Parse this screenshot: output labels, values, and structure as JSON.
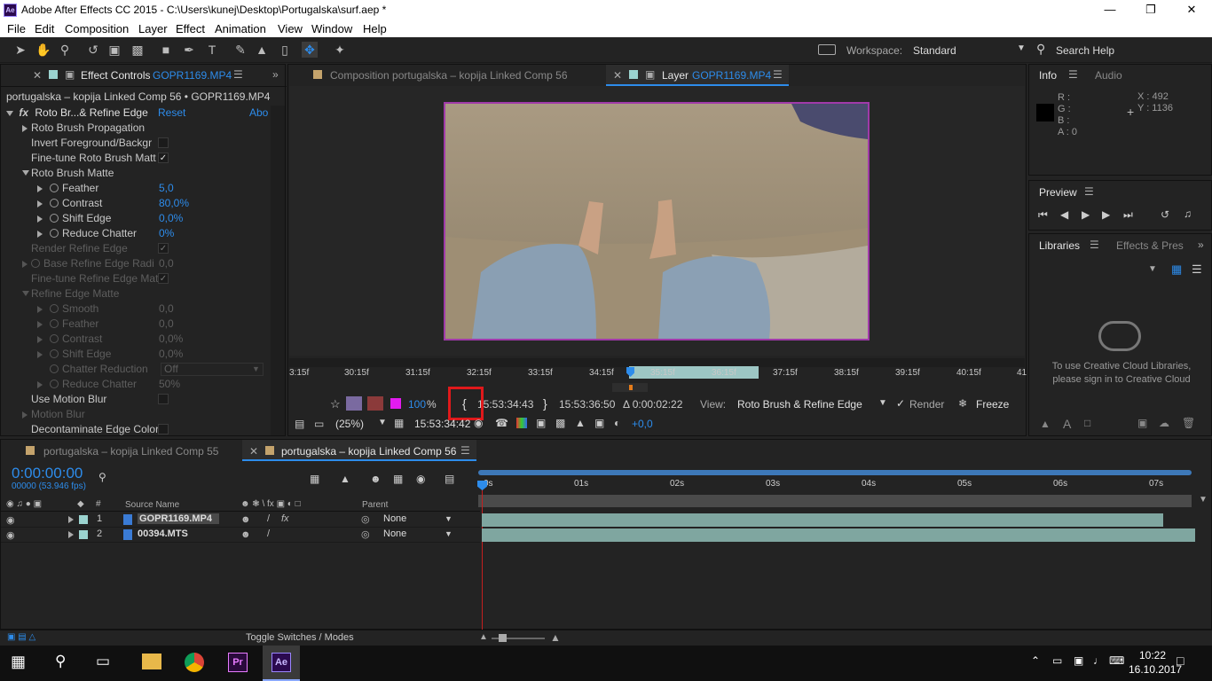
{
  "window": {
    "title": "Adobe After Effects CC 2015 - C:\\Users\\kunej\\Desktop\\Portugalska\\surf.aep *",
    "logo": "Ae"
  },
  "menu": [
    "File",
    "Edit",
    "Composition",
    "Layer",
    "Effect",
    "Animation",
    "View",
    "Window",
    "Help"
  ],
  "toolbar": {
    "workspace_label": "Workspace:",
    "workspace_value": "Standard",
    "search_placeholder": "Search Help"
  },
  "effect_panel": {
    "tab_label": "Effect Controls",
    "tab_file": "GOPR1169.MP4",
    "breadcrumb": "portugalska – kopija Linked Comp 56 • GOPR1169.MP4",
    "effect_name": "Roto Br...& Refine Edge",
    "reset": "Reset",
    "about": "Abo",
    "rows": [
      {
        "label": "Roto Brush Propagation",
        "value": "",
        "indent": 1,
        "tri": "closed",
        "dim": false,
        "check": null
      },
      {
        "label": "Invert Foreground/Backgr",
        "value": "",
        "indent": 1,
        "tri": "none",
        "dim": false,
        "check": "off"
      },
      {
        "label": "Fine-tune Roto Brush Matt",
        "value": "",
        "indent": 1,
        "tri": "none",
        "dim": false,
        "check": "on"
      },
      {
        "label": "Roto Brush Matte",
        "value": "",
        "indent": 1,
        "tri": "open",
        "dim": false,
        "check": null
      },
      {
        "label": "Feather",
        "value": "5,0",
        "indent": 2,
        "tri": "closed",
        "dim": false,
        "check": null,
        "sw": true
      },
      {
        "label": "Contrast",
        "value": "80,0%",
        "indent": 2,
        "tri": "closed",
        "dim": false,
        "check": null,
        "sw": true
      },
      {
        "label": "Shift Edge",
        "value": "0,0%",
        "indent": 2,
        "tri": "closed",
        "dim": false,
        "check": null,
        "sw": true
      },
      {
        "label": "Reduce Chatter",
        "value": "0%",
        "indent": 2,
        "tri": "closed",
        "dim": false,
        "check": null,
        "sw": true
      },
      {
        "label": "Render Refine Edge",
        "value": "",
        "indent": 1,
        "tri": "none",
        "dim": true,
        "check": "on"
      },
      {
        "label": "Base Refine Edge Radi",
        "value": "0,0",
        "indent": 1,
        "tri": "closed",
        "dim": true,
        "check": null,
        "sw": true
      },
      {
        "label": "Fine-tune Refine Edge Matt",
        "value": "",
        "indent": 1,
        "tri": "none",
        "dim": true,
        "check": "on"
      },
      {
        "label": "Refine Edge Matte",
        "value": "",
        "indent": 1,
        "tri": "open",
        "dim": true,
        "check": null
      },
      {
        "label": "Smooth",
        "value": "0,0",
        "indent": 2,
        "tri": "closed",
        "dim": true,
        "check": null,
        "sw": true
      },
      {
        "label": "Feather",
        "value": "0,0",
        "indent": 2,
        "tri": "closed",
        "dim": true,
        "check": null,
        "sw": true
      },
      {
        "label": "Contrast",
        "value": "0,0%",
        "indent": 2,
        "tri": "closed",
        "dim": true,
        "check": null,
        "sw": true
      },
      {
        "label": "Shift Edge",
        "value": "0,0%",
        "indent": 2,
        "tri": "closed",
        "dim": true,
        "check": null,
        "sw": true
      },
      {
        "label": "Chatter Reduction",
        "value": "Off",
        "indent": 2,
        "tri": "none",
        "dim": true,
        "check": null,
        "sw": true,
        "dropdown": true
      },
      {
        "label": "Reduce Chatter",
        "value": "50%",
        "indent": 2,
        "tri": "closed",
        "dim": true,
        "check": null,
        "sw": true
      },
      {
        "label": "Use Motion Blur",
        "value": "",
        "indent": 1,
        "tri": "none",
        "dim": false,
        "check": "off"
      },
      {
        "label": "Motion Blur",
        "value": "",
        "indent": 1,
        "tri": "closed",
        "dim": true,
        "check": null
      },
      {
        "label": "Decontaminate Edge Color",
        "value": "",
        "indent": 1,
        "tri": "none",
        "dim": false,
        "check": "off"
      }
    ]
  },
  "viewer_tabs": {
    "comp_tab": "Composition portugalska – kopija Linked Comp 56",
    "layer_tab_prefix": "Layer",
    "layer_tab_file": "GOPR1169.MP4"
  },
  "layer_ruler": [
    "3:15f",
    "30:15f",
    "31:15f",
    "32:15f",
    "33:15f",
    "34:15f",
    "35:15f",
    "36:15f",
    "37:15f",
    "38:15f",
    "39:15f",
    "40:15f",
    "41"
  ],
  "layer_controls": {
    "zoom_pct": "100",
    "pct": "%",
    "in_time": "15:53:34:43",
    "out_time": "15:53:36:50",
    "duration": "Δ 0:00:02:22",
    "view_label": "View:",
    "view_value": "Roto Brush & Refine Edge",
    "render": "Render",
    "freeze": "Freeze",
    "magnification": "(25%)",
    "current_time": "15:53:34:42",
    "exposure": "+0,0"
  },
  "info_panel": {
    "tabs": [
      "Info",
      "Audio"
    ],
    "r": "R :",
    "g": "G :",
    "b": "B :",
    "a": "A : 0",
    "x": "X : 492",
    "y": "Y : 1136"
  },
  "preview_panel": {
    "title": "Preview"
  },
  "libraries_panel": {
    "tabs": [
      "Libraries",
      "Effects & Pres"
    ],
    "message": "To use Creative Cloud Libraries, please sign in to Creative Cloud"
  },
  "timeline": {
    "tabs": [
      "portugalska – kopija Linked Comp 55",
      "portugalska – kopija Linked Comp 56"
    ],
    "timecode": "0:00:00:00",
    "fps": "00000 (53.946 fps)",
    "search_placeholder": "",
    "col_source": "Source Name",
    "col_num": "#",
    "col_parent": "Parent",
    "ruler": [
      "0s",
      "01s",
      "02s",
      "03s",
      "04s",
      "05s",
      "06s",
      "07s"
    ],
    "layers": [
      {
        "num": "1",
        "name": "GOPR1169.MP4",
        "parent": "None",
        "fx": "fx",
        "bar_start": 0.0,
        "bar_end": 0.955
      },
      {
        "num": "2",
        "name": "00394.MTS",
        "parent": "None",
        "fx": "",
        "bar_start": 0.0,
        "bar_end": 1.0
      }
    ],
    "toggle_label": "Toggle Switches / Modes"
  },
  "taskbar": {
    "time": "10:22",
    "date": "16.10.2017"
  },
  "colors": {
    "accent": "#2d8ceb",
    "highlight_box": "#e0191b",
    "layer_bar": "#7fa6a0",
    "playhead": "#c41f1f"
  }
}
